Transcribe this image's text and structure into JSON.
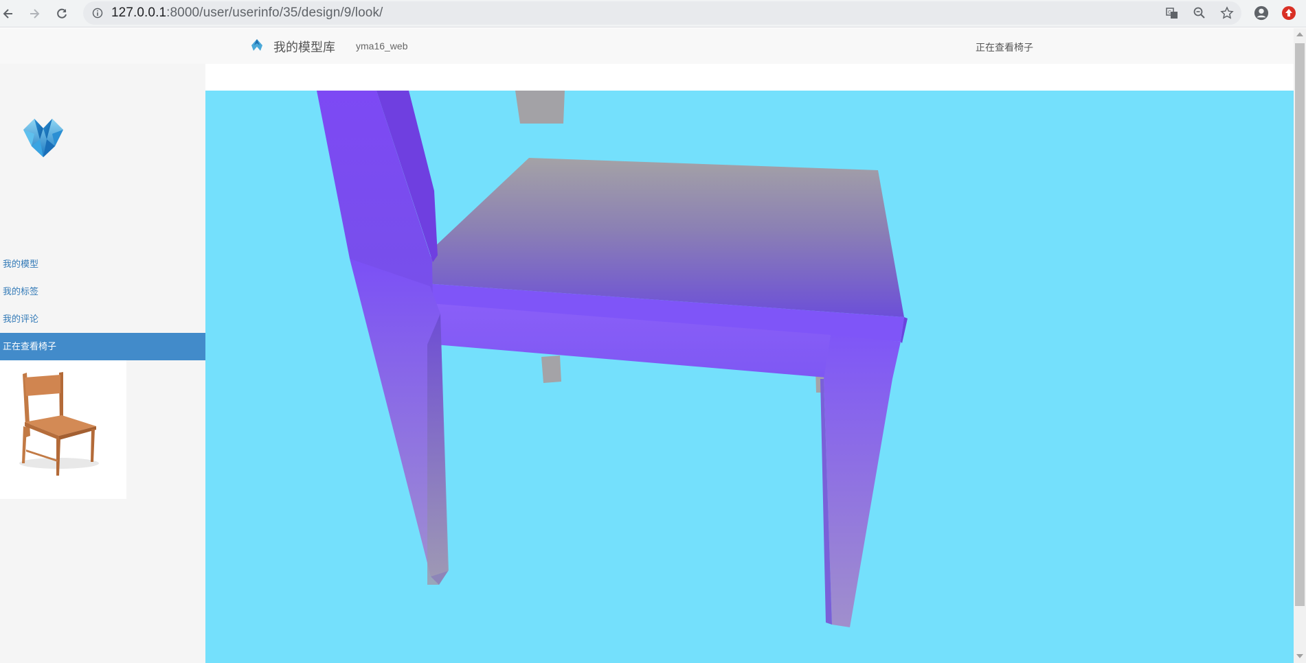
{
  "browser": {
    "url_host": "127.0.0.1",
    "url_path": ":8000/user/userinfo/35/design/9/look/"
  },
  "nav": {
    "brand": "我的模型库",
    "username": "yma16_web",
    "viewing": "正在查看椅子"
  },
  "sidebar": {
    "items": [
      {
        "label": "我的模型"
      },
      {
        "label": "我的标签"
      },
      {
        "label": "我的评论"
      },
      {
        "label": "正在查看椅子"
      }
    ]
  },
  "colors": {
    "viewer_background": "#74e0fc",
    "chair_purple": "#7e55f5",
    "chair_gray": "#a09fa3",
    "active_item": "#428bca",
    "link": "#337ab7"
  }
}
